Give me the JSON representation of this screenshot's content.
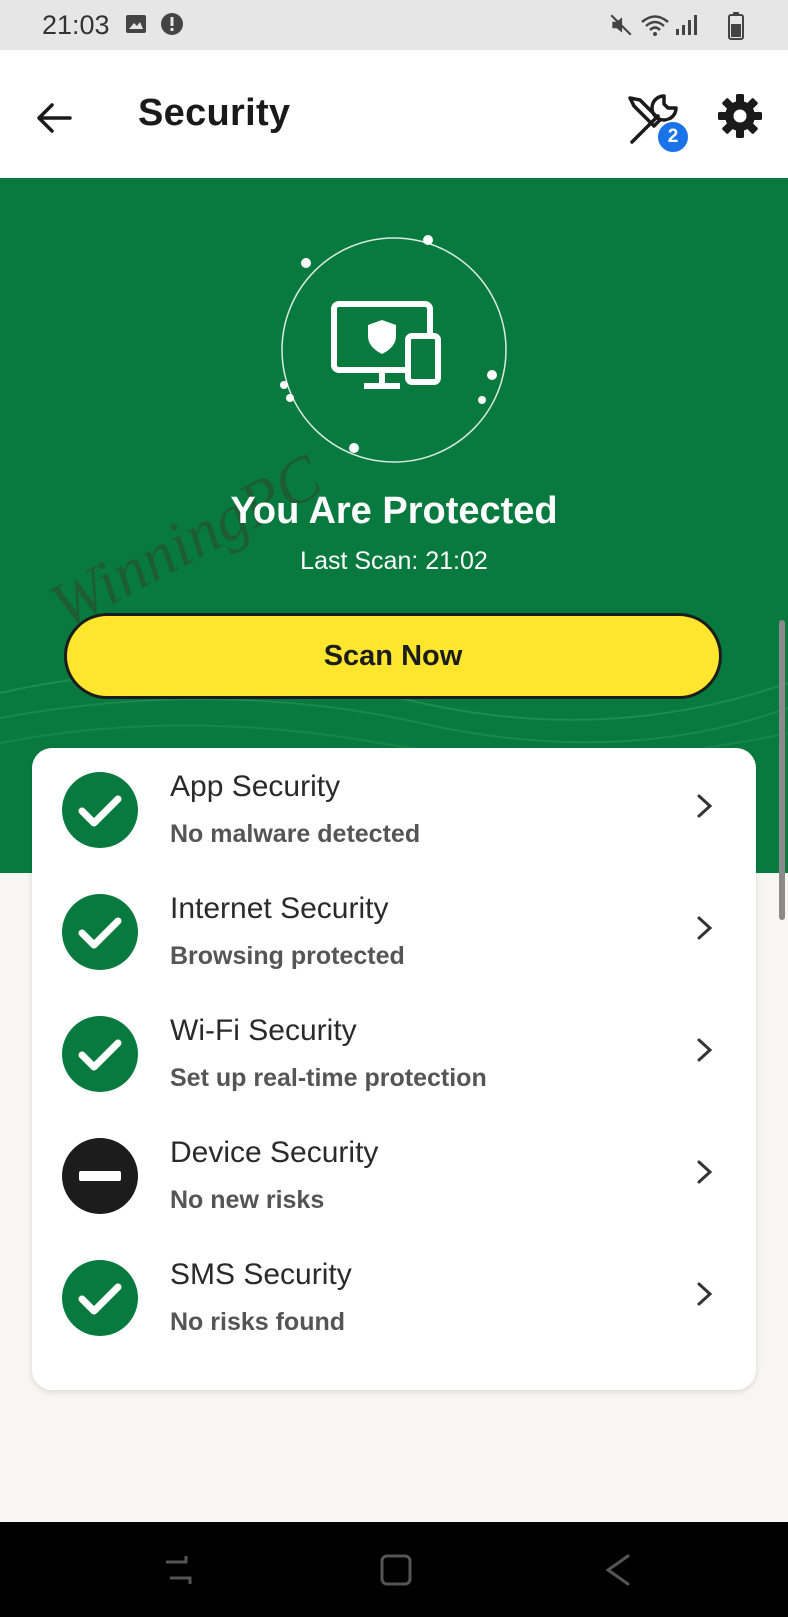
{
  "status_bar": {
    "time": "21:03",
    "left_icons": [
      "image-icon",
      "alert-icon"
    ],
    "right_icons": [
      "mute-icon",
      "wifi-icon",
      "signal-icon",
      "battery-icon"
    ]
  },
  "app_bar": {
    "title": "Security",
    "tools_badge": "2",
    "icons": [
      "back-arrow-icon",
      "tools-icon",
      "gear-icon"
    ]
  },
  "hero": {
    "icon": "device-shield-icon",
    "title": "You Are Protected",
    "subtitle": "Last Scan: 21:02",
    "scan_button": "Scan Now",
    "watermark": "WinningPC"
  },
  "features": [
    {
      "title": "App Security",
      "status": "No malware detected",
      "state": "ok"
    },
    {
      "title": "Internet Security",
      "status": "Browsing protected",
      "state": "ok"
    },
    {
      "title": "Wi-Fi Security",
      "status": "Set up real-time protection",
      "state": "ok"
    },
    {
      "title": "Device Security",
      "status": "No new risks",
      "state": "neutral"
    },
    {
      "title": "SMS Security",
      "status": "No risks found",
      "state": "ok"
    }
  ],
  "nav_bar": {
    "icons": [
      "recents-icon",
      "home-icon",
      "back-icon"
    ]
  },
  "colors": {
    "brand_green": "#087a3f",
    "scan_yellow": "#fde62d",
    "badge_blue": "#1a73e8",
    "neutral_black": "#1c1c1c"
  }
}
